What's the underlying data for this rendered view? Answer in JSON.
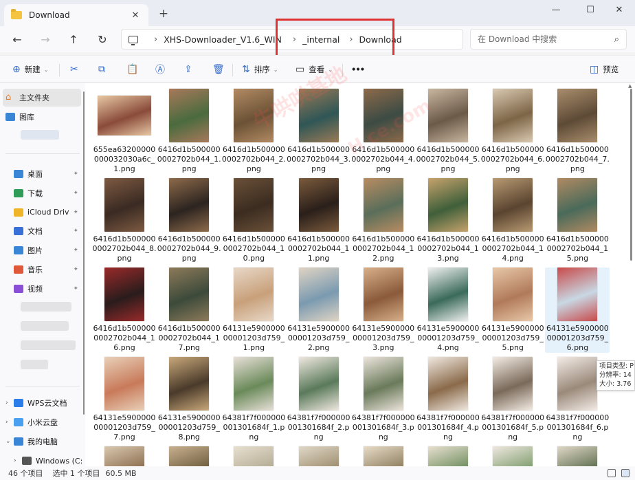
{
  "window": {
    "tab_title": "Download",
    "tab_close": "✕",
    "new_tab": "+",
    "minimize": "—",
    "maximize": "☐",
    "close": "✕"
  },
  "nav": {
    "back": "←",
    "forward": "→",
    "up": "↑",
    "refresh": "↻",
    "breadcrumbs": [
      "XHS-Downloader_V1.6_WIN",
      "_internal",
      "Download"
    ],
    "search_placeholder": "在 Download 中搜索"
  },
  "toolbar": {
    "new_label": "新建",
    "sort_label": "排序",
    "view_label": "查看",
    "more_label": "•••",
    "preview_label": "预览",
    "caret": "⌄"
  },
  "sidebar": {
    "home": "主文件夹",
    "gallery": "图库",
    "quick_access": [
      {
        "label": "桌面",
        "color": "#3a86d6"
      },
      {
        "label": "下载",
        "color": "#2f9d58"
      },
      {
        "label": "iCloud Driv",
        "color": "#f0b429"
      },
      {
        "label": "文档",
        "color": "#3a6fd6"
      },
      {
        "label": "图片",
        "color": "#3a86d6"
      },
      {
        "label": "音乐",
        "color": "#e0583a"
      },
      {
        "label": "视频",
        "color": "#8a4fd6"
      }
    ],
    "drives": [
      {
        "label": "WPS云文档",
        "color": "#2b7de9"
      },
      {
        "label": "小米云盘",
        "color": "#4aa0f0"
      },
      {
        "label": "我的电脑",
        "color": "#3a86d6"
      },
      {
        "label": "Windows (C:",
        "color": "#555555"
      }
    ],
    "pin_glyph": "📌",
    "expand": "›",
    "expanded": "⌄"
  },
  "files": [
    {
      "name": "655ea63200000000032030a6c_1.png",
      "w": 78,
      "h": 58,
      "c1": "#8a4b3a",
      "c2": "#e7c8a4"
    },
    {
      "name": "6416d1b5000000002702b044_1.png",
      "w": 58,
      "h": 78,
      "c1": "#4a6b3e",
      "c2": "#a8795a"
    },
    {
      "name": "6416d1b5000000002702b044_2.png",
      "w": 58,
      "h": 78,
      "c1": "#6b5236",
      "c2": "#b28a62"
    },
    {
      "name": "6416d1b5000000002702b044_3.png",
      "w": 58,
      "h": 78,
      "c1": "#2f5656",
      "c2": "#9a7a56"
    },
    {
      "name": "6416d1b5000000002702b044_4.png",
      "w": 58,
      "h": 78,
      "c1": "#3c4b44",
      "c2": "#8d6a4a"
    },
    {
      "name": "6416d1b5000000002702b044_5.png",
      "w": 58,
      "h": 78,
      "c1": "#6b5a48",
      "c2": "#c8b6a0"
    },
    {
      "name": "6416d1b5000000002702b044_6.png",
      "w": 58,
      "h": 78,
      "c1": "#7d6446",
      "c2": "#d9cab2"
    },
    {
      "name": "6416d1b5000000002702b044_7.png",
      "w": 58,
      "h": 78,
      "c1": "#5d4a36",
      "c2": "#a98d6c"
    },
    {
      "name": "6416d1b5000000002702b044_8.png",
      "w": 58,
      "h": 78,
      "c1": "#3a2a22",
      "c2": "#7d5a42"
    },
    {
      "name": "6416d1b5000000002702b044_9.png",
      "w": 58,
      "h": 78,
      "c1": "#2c2420",
      "c2": "#8d6a4a"
    },
    {
      "name": "6416d1b5000000002702b044_10.png",
      "w": 58,
      "h": 78,
      "c1": "#3b2c20",
      "c2": "#6a5038"
    },
    {
      "name": "6416d1b5000000002702b044_11.png",
      "w": 58,
      "h": 78,
      "c1": "#2a1f1a",
      "c2": "#7a5a3c"
    },
    {
      "name": "6416d1b5000000002702b044_12.png",
      "w": 58,
      "h": 78,
      "c1": "#5a6e5a",
      "c2": "#b88c62"
    },
    {
      "name": "6416d1b5000000002702b044_13.png",
      "w": 58,
      "h": 78,
      "c1": "#3f5f3a",
      "c2": "#c6a26c"
    },
    {
      "name": "6416d1b5000000002702b044_14.png",
      "w": 58,
      "h": 78,
      "c1": "#5a4430",
      "c2": "#b89a72"
    },
    {
      "name": "6416d1b5000000002702b044_15.png",
      "w": 58,
      "h": 78,
      "c1": "#4a6a5a",
      "c2": "#b08a62"
    },
    {
      "name": "6416d1b5000000002702b044_16.png",
      "w": 58,
      "h": 78,
      "c1": "#2a1c1c",
      "c2": "#9a2a2a"
    },
    {
      "name": "6416d1b5000000002702b044_17.png",
      "w": 58,
      "h": 78,
      "c1": "#3c4a3a",
      "c2": "#8d7a5a"
    },
    {
      "name": "64131e590000000001203d759_1.png",
      "w": 58,
      "h": 78,
      "c1": "#c8a07a",
      "c2": "#e8d8c8"
    },
    {
      "name": "64131e590000000001203d759_2.png",
      "w": 58,
      "h": 78,
      "c1": "#7a9ab0",
      "c2": "#e0d4c4"
    },
    {
      "name": "64131e590000000001203d759_3.png",
      "w": 58,
      "h": 78,
      "c1": "#8a5a3a",
      "c2": "#d8b08a"
    },
    {
      "name": "64131e590000000001203d759_4.png",
      "w": 58,
      "h": 78,
      "c1": "#3a6a5a",
      "c2": "#f0f0f0"
    },
    {
      "name": "64131e590000000001203d759_5.png",
      "w": 58,
      "h": 78,
      "c1": "#b07a5a",
      "c2": "#e8c8a8"
    },
    {
      "name": "64131e590000000001203d759_6.png",
      "w": 58,
      "h": 78,
      "c1": "#c8d8e4",
      "c2": "#c84a4a"
    },
    {
      "name": "64131e590000000001203d759_7.png",
      "w": 58,
      "h": 78,
      "c1": "#c87a5a",
      "c2": "#e8d0b8"
    },
    {
      "name": "64131e590000000001203d759_8.png",
      "w": 58,
      "h": 78,
      "c1": "#4a3a2a",
      "c2": "#c8a87a"
    },
    {
      "name": "64381f7f000000001301684f_1.png",
      "w": 58,
      "h": 78,
      "c1": "#6a8a5a",
      "c2": "#e8e0d8"
    },
    {
      "name": "64381f7f000000001301684f_2.png",
      "w": 58,
      "h": 78,
      "c1": "#5a7a5a",
      "c2": "#f0e8e0"
    },
    {
      "name": "64381f7f000000001301684f_3.png",
      "w": 58,
      "h": 78,
      "c1": "#6a7a5a",
      "c2": "#ece4dc"
    },
    {
      "name": "64381f7f000000001301684f_4.png",
      "w": 58,
      "h": 78,
      "c1": "#8a6a4a",
      "c2": "#f0e8e0"
    },
    {
      "name": "64381f7f000000001301684f_5.png",
      "w": 58,
      "h": 78,
      "c1": "#7a6a5a",
      "c2": "#f4ece4"
    },
    {
      "name": "64381f7f000000001301684f_6.png",
      "w": 58,
      "h": 78,
      "c1": "#9a8a7a",
      "c2": "#f4ece8"
    },
    {
      "name": "",
      "w": 58,
      "h": 78,
      "c1": "#8a6a4a",
      "c2": "#d8c8b0"
    },
    {
      "name": "",
      "w": 58,
      "h": 78,
      "c1": "#6a5a3a",
      "c2": "#c8b090"
    },
    {
      "name": "",
      "w": 58,
      "h": 78,
      "c1": "#b0a890",
      "c2": "#e8e0d0"
    },
    {
      "name": "",
      "w": 58,
      "h": 78,
      "c1": "#9a8a6a",
      "c2": "#e0d8c8"
    },
    {
      "name": "",
      "w": 58,
      "h": 78,
      "c1": "#8a7a5a",
      "c2": "#e8dcc8"
    },
    {
      "name": "",
      "w": 58,
      "h": 78,
      "c1": "#6a8a5a",
      "c2": "#e8e0d0"
    },
    {
      "name": "",
      "w": 58,
      "h": 78,
      "c1": "#7a9a6a",
      "c2": "#f0e8e0"
    },
    {
      "name": "",
      "w": 58,
      "h": 78,
      "c1": "#5a6a4a",
      "c2": "#e0d8c8"
    }
  ],
  "selected_index": 23,
  "tooltip": {
    "line1": "项目类型: P",
    "line2": "分辨率: 14",
    "line3": "大小: 3.76"
  },
  "status": {
    "count": "46 个项目",
    "selection": "选中 1 个项目",
    "size": "60.5 MB"
  },
  "watermark": {
    "text1": "牛哄哄基地",
    "text2": "H  ce.com"
  },
  "colors": {
    "accent": "#3068c9",
    "highlight_box": "#e03131",
    "selected_bg": "#e5f1fb"
  }
}
